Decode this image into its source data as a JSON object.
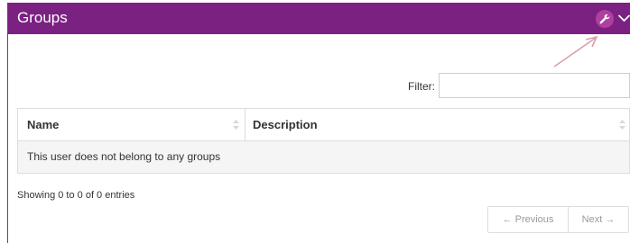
{
  "panel": {
    "title": "Groups",
    "header_color": "#7a2182",
    "icons": {
      "settings": "wrench-icon",
      "collapse": "chevron-down-icon"
    }
  },
  "filter": {
    "label": "Filter:",
    "value": "",
    "placeholder": ""
  },
  "table": {
    "columns": [
      "Name",
      "Description"
    ],
    "empty_message": "This user does not belong to any groups"
  },
  "info": "Showing 0 to 0 of 0 entries",
  "pagination": {
    "previous": "← Previous",
    "next": "Next →"
  },
  "annotation": {
    "arrow_color": "#d9a0a8"
  }
}
